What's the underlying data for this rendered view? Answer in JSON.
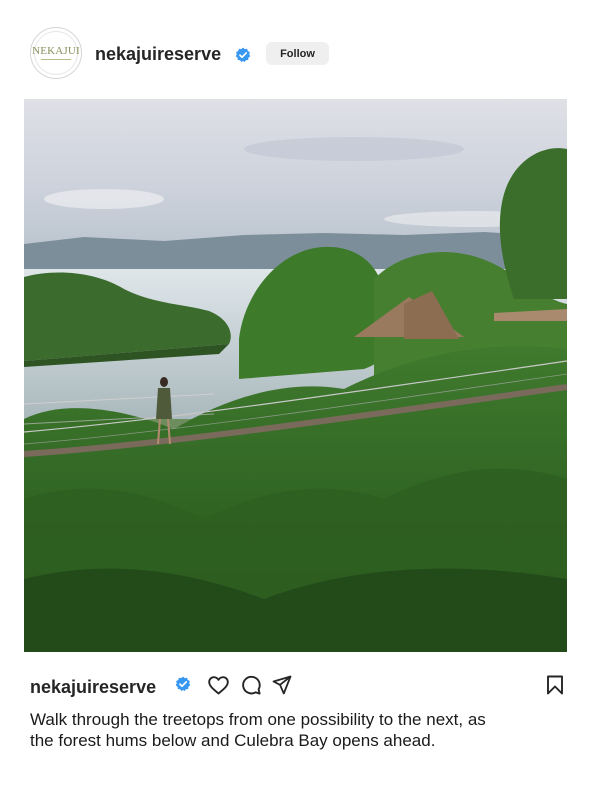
{
  "post": {
    "account": {
      "username": "nekajuireserve",
      "avatar_text": "NEKAJUI",
      "verified_icon": "verified-badge-icon",
      "verified_color": "#3897f0"
    },
    "follow_label": "Follow",
    "image": {
      "description_icon": "photo"
    },
    "actions": {
      "like_icon": "heart-icon",
      "comment_icon": "comment-icon",
      "share_icon": "send-icon",
      "save_icon": "bookmark-icon"
    },
    "caption": "Walk through the treetops from one possibility to the next, as the forest hums below and Culebra Bay opens ahead."
  }
}
